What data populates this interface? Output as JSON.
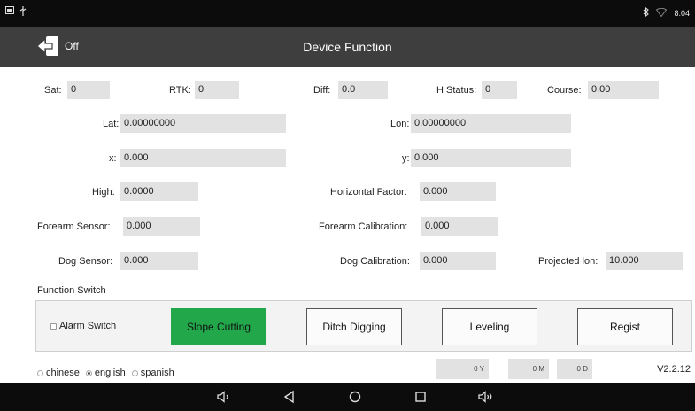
{
  "status_bar": {
    "time": "8:04",
    "left_icons": [
      "screenshot-icon",
      "usb-icon"
    ],
    "right_icons": [
      "bluetooth-icon",
      "wifi-icon"
    ]
  },
  "header": {
    "back_label": "Off",
    "title": "Device Function"
  },
  "fields": {
    "sat": {
      "label": "Sat:",
      "value": "0"
    },
    "rtk": {
      "label": "RTK:",
      "value": "0"
    },
    "diff": {
      "label": "Diff:",
      "value": "0.0"
    },
    "h_status": {
      "label": "H Status:",
      "value": "0"
    },
    "course": {
      "label": "Course:",
      "value": "0.00"
    },
    "lat": {
      "label": "Lat:",
      "value": "0.00000000"
    },
    "lon": {
      "label": "Lon:",
      "value": "0.00000000"
    },
    "x": {
      "label": "x:",
      "value": "0.000"
    },
    "y": {
      "label": "y:",
      "value": "0.000"
    },
    "high": {
      "label": "High:",
      "value": "0.0000"
    },
    "horizontal_factor": {
      "label": "Horizontal Factor:",
      "value": "0.000"
    },
    "forearm_sensor": {
      "label": "Forearm Sensor:",
      "value": "0.000"
    },
    "forearm_calibration": {
      "label": "Forearm Calibration:",
      "value": "0.000"
    },
    "dog_sensor": {
      "label": "Dog Sensor:",
      "value": "0.000"
    },
    "dog_calibration": {
      "label": "Dog Calibration:",
      "value": "0.000"
    },
    "projected_lon": {
      "label": "Projected lon:",
      "value": "10.000"
    }
  },
  "function_switch": {
    "title": "Function Switch",
    "alarm_label": "Alarm Switch",
    "alarm_checked": false,
    "buttons": [
      {
        "label": "Slope Cutting",
        "active": true
      },
      {
        "label": "Ditch Digging",
        "active": false
      },
      {
        "label": "Leveling",
        "active": false
      },
      {
        "label": "Regist",
        "active": false
      }
    ]
  },
  "language": {
    "options": [
      "chinese",
      "english",
      "spanish"
    ],
    "selected": "english"
  },
  "date": {
    "year": "0 Y",
    "month": "0 M",
    "day": "0 D"
  },
  "version": "V2.2.12",
  "colors": {
    "status_bar": "#0c0c0c",
    "title_bar": "#3e3e3e",
    "field_bg": "#e2e2e2",
    "active_button": "#22a84a",
    "nav_bar": "#0c0c0c"
  },
  "nav_icons": [
    "volume-down-icon",
    "back-icon",
    "home-icon",
    "recents-icon",
    "volume-up-icon"
  ]
}
